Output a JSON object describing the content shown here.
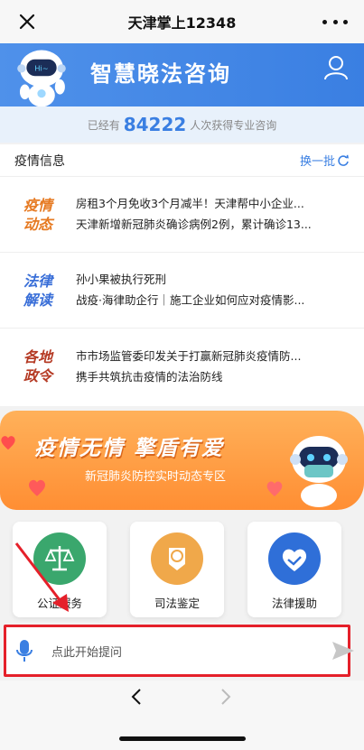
{
  "topbar": {
    "title": "天津掌上12348",
    "close_icon": "close-icon",
    "more_icon": "more-icon"
  },
  "banner": {
    "title": "智慧晓法咨询",
    "robot_icon": "robot-mascot-icon",
    "user_icon": "user-icon"
  },
  "stats": {
    "prefix": "已经有",
    "count": "84222",
    "suffix": "人次获得专业咨询"
  },
  "news": {
    "heading": "疫情信息",
    "refresh_label": "换一批",
    "rows": [
      {
        "badge_line1": "疫情",
        "badge_line2": "动态",
        "items": [
          "房租3个月免收3个月减半！天津帮中小企业...",
          "天津新增新冠肺炎确诊病例2例，累计确诊13..."
        ]
      },
      {
        "badge_line1": "法律",
        "badge_line2": "解读",
        "items": [
          "孙小果被执行死刑",
          "战疫·海律助企行｜施工企业如何应对疫情影..."
        ]
      },
      {
        "badge_line1": "各地",
        "badge_line2": "政令",
        "items": [
          "市市场监管委印发关于打赢新冠肺炎疫情防...",
          "携手共筑抗击疫情的法治防线"
        ]
      }
    ]
  },
  "promo": {
    "title": "疫情无情  擎盾有爱",
    "subtitle": "新冠肺炎防控实时动态专区"
  },
  "services": [
    {
      "label": "公证服务",
      "icon": "scales-icon",
      "color": "#3aa76d"
    },
    {
      "label": "司法鉴定",
      "icon": "certificate-icon",
      "color": "#f0a84a"
    },
    {
      "label": "法律援助",
      "icon": "handshake-heart-icon",
      "color": "#2f6fd8"
    }
  ],
  "input": {
    "placeholder": "点此开始提问",
    "mic_icon": "microphone-icon",
    "send_icon": "send-icon"
  },
  "navbar": {
    "back_icon": "chevron-left-icon",
    "forward_icon": "chevron-right-icon"
  },
  "colors": {
    "brand_blue": "#3a7fe2",
    "highlight_red": "#e5202a",
    "promo_orange": "#ff8e33"
  }
}
